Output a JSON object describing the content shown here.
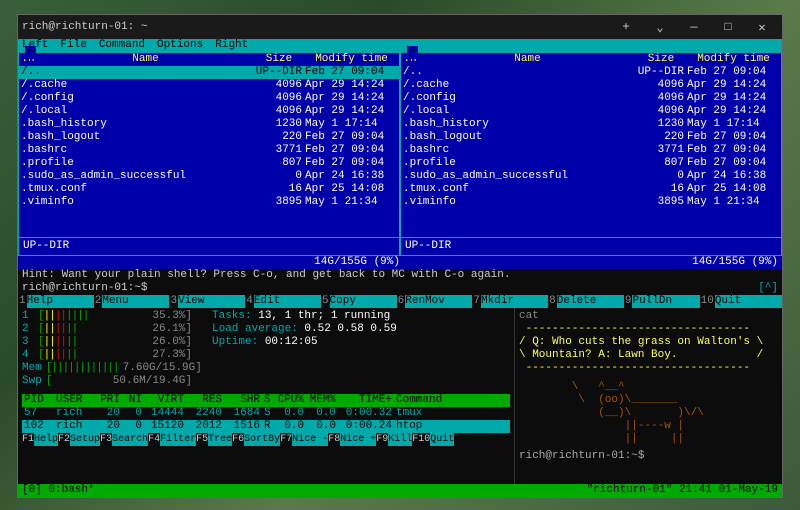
{
  "window": {
    "title": "rich@richturn-01: ~",
    "plus": "+",
    "down": "⌄"
  },
  "mc": {
    "menu": [
      "Left",
      "File",
      "Command",
      "Options",
      "Right"
    ],
    "tab": "~",
    "headers": {
      "subname": ".n",
      "name": "Name",
      "size": "Size",
      "time": "Modify time"
    },
    "filesLeft": [
      {
        "name": "/..",
        "size": "UP--DIR",
        "time": "Feb 27 09:04",
        "sel": true
      },
      {
        "name": "/.cache",
        "size": "4096",
        "time": "Apr 29 14:24"
      },
      {
        "name": "/.config",
        "size": "4096",
        "time": "Apr 29 14:24"
      },
      {
        "name": "/.local",
        "size": "4096",
        "time": "Apr 29 14:24"
      },
      {
        "name": ".bash_history",
        "size": "1230",
        "time": "May  1 17:14"
      },
      {
        "name": ".bash_logout",
        "size": "220",
        "time": "Feb 27 09:04"
      },
      {
        "name": ".bashrc",
        "size": "3771",
        "time": "Feb 27 09:04"
      },
      {
        "name": ".profile",
        "size": "807",
        "time": "Feb 27 09:04"
      },
      {
        "name": ".sudo_as_admin_successful",
        "size": "0",
        "time": "Apr 24 16:38"
      },
      {
        "name": ".tmux.conf",
        "size": "16",
        "time": "Apr 25 14:08"
      },
      {
        "name": ".viminfo",
        "size": "3895",
        "time": "May  1 21:34"
      }
    ],
    "filesRight": [
      {
        "name": "/..",
        "size": "UP--DIR",
        "time": "Feb 27 09:04"
      },
      {
        "name": "/.cache",
        "size": "4096",
        "time": "Apr 29 14:24"
      },
      {
        "name": "/.config",
        "size": "4096",
        "time": "Apr 29 14:24"
      },
      {
        "name": "/.local",
        "size": "4096",
        "time": "Apr 29 14:24"
      },
      {
        "name": ".bash_history",
        "size": "1230",
        "time": "May  1 17:14"
      },
      {
        "name": ".bash_logout",
        "size": "220",
        "time": "Feb 27 09:04"
      },
      {
        "name": ".bashrc",
        "size": "3771",
        "time": "Feb 27 09:04"
      },
      {
        "name": ".profile",
        "size": "807",
        "time": "Feb 27 09:04"
      },
      {
        "name": ".sudo_as_admin_successful",
        "size": "0",
        "time": "Apr 24 16:38"
      },
      {
        "name": ".tmux.conf",
        "size": "16",
        "time": "Apr 25 14:08"
      },
      {
        "name": ".viminfo",
        "size": "3895",
        "time": "May  1 21:34"
      }
    ],
    "statusLeft": "UP--DIR",
    "statusRight": "UP--DIR",
    "diskLeft": "14G/155G (9%)",
    "diskRight": "14G/155G (9%)",
    "hint": "Hint: Want your plain shell? Press C-o, and get back to MC with C-o again.",
    "prompt": "rich@richturn-01:~$",
    "caret": "[^]",
    "fnkeys": [
      {
        "n": "1",
        "l": "Help"
      },
      {
        "n": "2",
        "l": "Menu"
      },
      {
        "n": "3",
        "l": "View"
      },
      {
        "n": "4",
        "l": "Edit"
      },
      {
        "n": "5",
        "l": "Copy"
      },
      {
        "n": "6",
        "l": "RenMov"
      },
      {
        "n": "7",
        "l": "Mkdir"
      },
      {
        "n": "8",
        "l": "Delete"
      },
      {
        "n": "9",
        "l": "PullDn"
      },
      {
        "n": "10",
        "l": "Quit"
      }
    ]
  },
  "htop": {
    "cpus": [
      {
        "n": "1",
        "bar": "[|||||||| ",
        "pct": "35.3%]"
      },
      {
        "n": "2",
        "bar": "[|||||| ",
        "pct": "26.1%]"
      },
      {
        "n": "3",
        "bar": "[|||||| ",
        "pct": "26.0%]"
      },
      {
        "n": "4",
        "bar": "[|||||| ",
        "pct": "27.3%]"
      }
    ],
    "mem": {
      "label": "Mem",
      "bar": "[||||||||||||",
      "val": "7.60G/15.9G]"
    },
    "swp": {
      "label": "Swp",
      "bar": "[",
      "val": "50.6M/19.4G]"
    },
    "tasks_lbl": "Tasks: ",
    "tasks_val": "13, 1 thr; 1 running",
    "load_lbl": "Load average: ",
    "load_val": "0.52 0.58 0.59",
    "uptime_lbl": "Uptime: ",
    "uptime_val": "00:12:05",
    "hdrs": {
      "pid": "PID",
      "user": "USER",
      "pri": "PRI",
      "ni": "NI",
      "virt": "VIRT",
      "res": "RES",
      "shr": "SHR",
      "s": "S",
      "cpu": "CPU%",
      "mem": "MEM%",
      "time": "TIME+",
      "cmd": "Command"
    },
    "rows": [
      {
        "pid": "57",
        "user": "rich",
        "pri": "20",
        "ni": "0",
        "virt": "14444",
        "res": "2240",
        "shr": "1684",
        "s": "S",
        "cpu": "0.0",
        "mem": "0.0",
        "time": "0:00.32",
        "cmd": "tmux"
      },
      {
        "pid": "102",
        "user": "rich",
        "pri": "20",
        "ni": "0",
        "virt": "15120",
        "res": "2012",
        "shr": "1516",
        "s": "R",
        "cpu": "0.0",
        "mem": "0.0",
        "time": "0:00.24",
        "cmd": "htop",
        "hl": true
      }
    ],
    "fnkeys": [
      {
        "n": "F1",
        "l": "Help"
      },
      {
        "n": "F2",
        "l": "Setup"
      },
      {
        "n": "F3",
        "l": "Search"
      },
      {
        "n": "F4",
        "l": "Filter"
      },
      {
        "n": "F5",
        "l": "Tree"
      },
      {
        "n": "F6",
        "l": "SortBy"
      },
      {
        "n": "F7",
        "l": "Nice -"
      },
      {
        "n": "F8",
        "l": "Nice +"
      },
      {
        "n": "F9",
        "l": "Kill"
      },
      {
        "n": "F10",
        "l": "Quit"
      }
    ]
  },
  "cow": {
    "cmd": "cat",
    "q": "/ Q: Who cuts the grass on Walton's \\",
    "a": "\\ Mountain? A: Lawn Boy.            /",
    "border": " ----------------------------------",
    "art1": "        \\   ^__^",
    "art2": "         \\  (oo)\\_______",
    "art3": "            (__)\\       )\\/\\",
    "art4": "                ||----w |",
    "art5": "                ||     ||",
    "prompt": "rich@richturn-01:~$"
  },
  "tmux": {
    "left": "[0] 0:bash*",
    "right": "\"richturn-01\" 21:41 01-May-19"
  }
}
